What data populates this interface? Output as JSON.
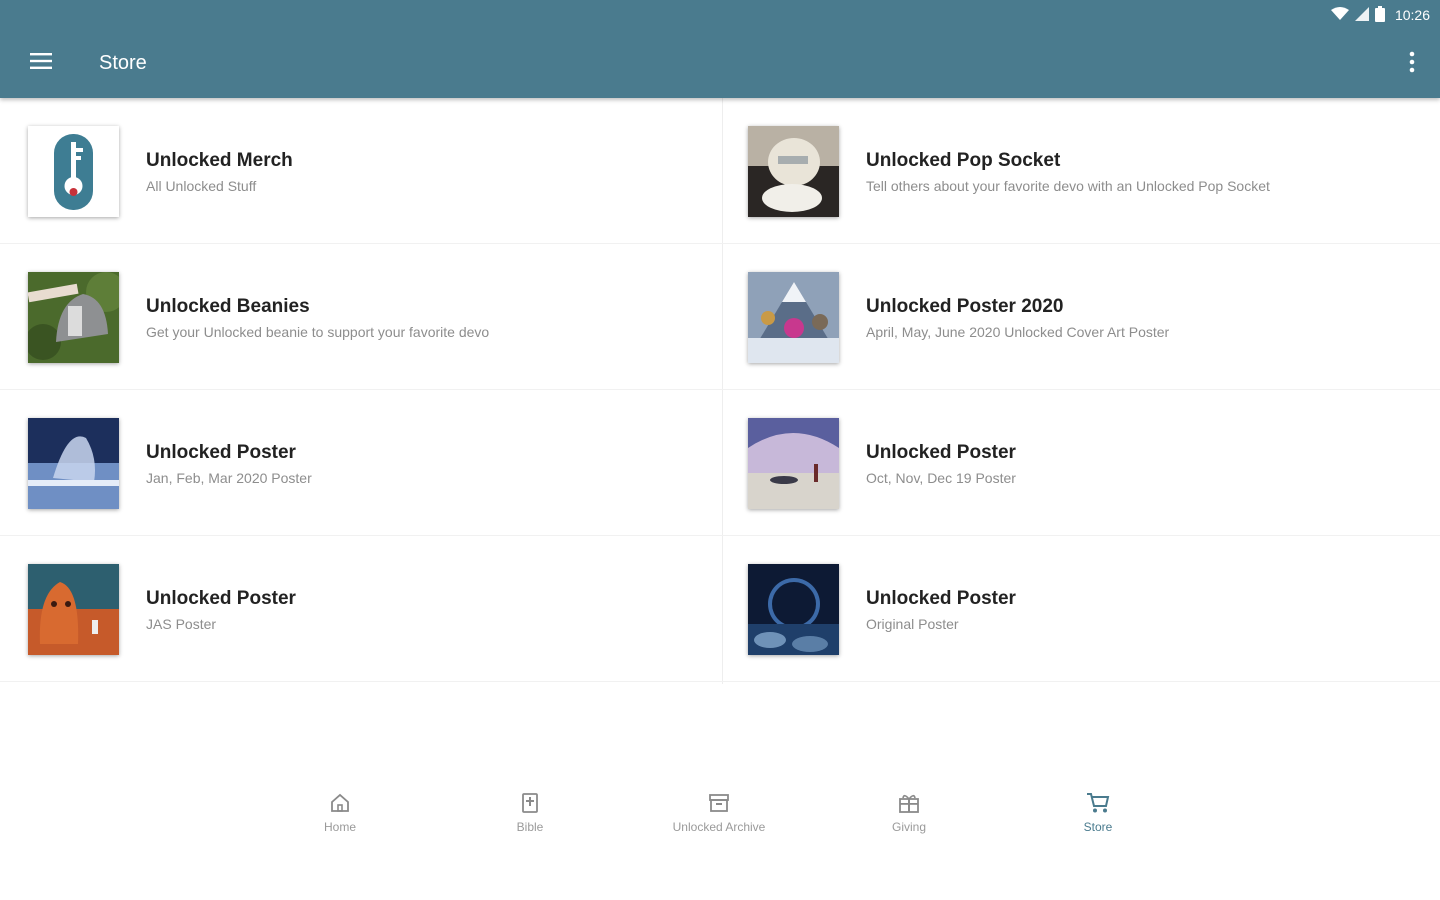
{
  "status_bar": {
    "time": "10:26"
  },
  "app_bar": {
    "title": "Store"
  },
  "store_items": [
    {
      "title": "Unlocked Merch",
      "subtitle": "All Unlocked Stuff",
      "thumb": "key-logo"
    },
    {
      "title": "Unlocked Pop Socket",
      "subtitle": "Tell others about your favorite devo with an Unlocked Pop Socket",
      "thumb": "pop-socket-photo"
    },
    {
      "title": "Unlocked Beanies",
      "subtitle": "Get your Unlocked beanie to support your favorite devo",
      "thumb": "beanie-photo"
    },
    {
      "title": "Unlocked Poster 2020",
      "subtitle": "April, May, June 2020 Unlocked Cover Art Poster",
      "thumb": "mountain-poster"
    },
    {
      "title": "Unlocked Poster",
      "subtitle": "Jan, Feb, Mar 2020 Poster",
      "thumb": "ice-poster"
    },
    {
      "title": "Unlocked Poster",
      "subtitle": "Oct, Nov, Dec 19 Poster",
      "thumb": "sky-poster"
    },
    {
      "title": "Unlocked Poster",
      "subtitle": "JAS Poster",
      "thumb": "mars-poster"
    },
    {
      "title": "Unlocked Poster",
      "subtitle": "Original Poster",
      "thumb": "planet-poster"
    }
  ],
  "bottom_nav": [
    {
      "label": "Home",
      "icon": "home-icon"
    },
    {
      "label": "Bible",
      "icon": "bible-icon"
    },
    {
      "label": "Unlocked Archive",
      "icon": "archive-icon"
    },
    {
      "label": "Giving",
      "icon": "gift-icon"
    },
    {
      "label": "Store",
      "icon": "cart-icon",
      "active": true
    }
  ],
  "colors": {
    "primary": "#4a7b8e",
    "nav_inactive": "#9a9a9a",
    "title_text": "#222222",
    "subtitle_text": "#8d8d8d"
  }
}
